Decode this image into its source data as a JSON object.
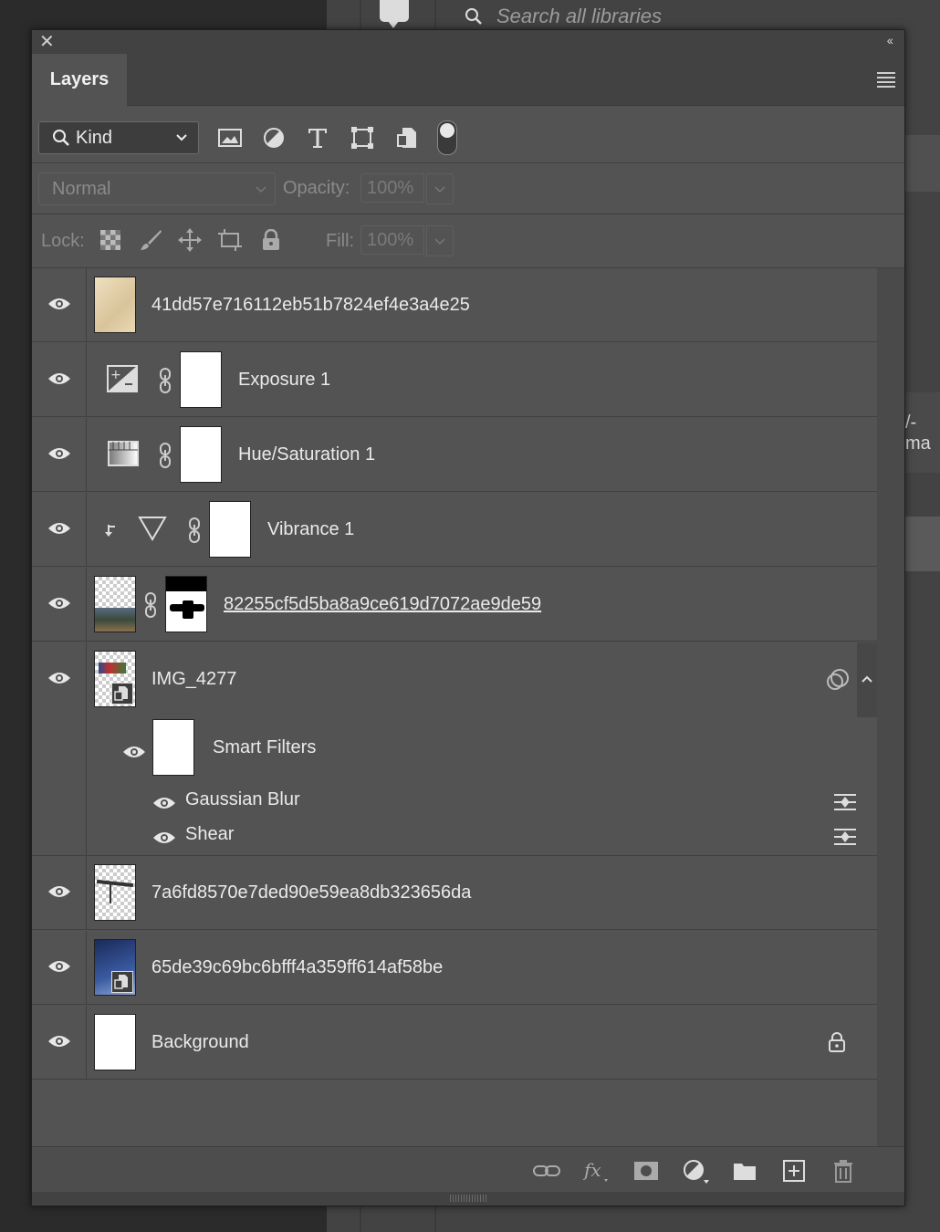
{
  "background": {
    "search_placeholder": "Search all libraries",
    "side_text": "/-ma"
  },
  "panel": {
    "tab_label": "Layers",
    "filter": {
      "kind_label": "Kind"
    },
    "blend": {
      "mode": "Normal",
      "opacity_label": "Opacity:",
      "opacity_value": "100%"
    },
    "lock": {
      "label": "Lock:",
      "fill_label": "Fill:",
      "fill_value": "100%"
    },
    "layers": [
      {
        "name": "41dd57e716112eb51b7824ef4e3a4e25"
      },
      {
        "name": "Exposure 1"
      },
      {
        "name": "Hue/Saturation 1"
      },
      {
        "name": "Vibrance 1"
      },
      {
        "name": "82255cf5d5ba8a9ce619d7072ae9de59"
      },
      {
        "name": "IMG_4277",
        "smart_filters_label": "Smart Filters",
        "filters": [
          "Gaussian Blur",
          "Shear"
        ]
      },
      {
        "name": "7a6fd8570e7ded90e59ea8db323656da"
      },
      {
        "name": "65de39c69bc6bfff4a359ff614af58be"
      },
      {
        "name": "Background"
      }
    ]
  },
  "colors": {
    "panel_bg": "#535353",
    "header_bg": "#424242",
    "app_bg": "#2b2b2b"
  }
}
